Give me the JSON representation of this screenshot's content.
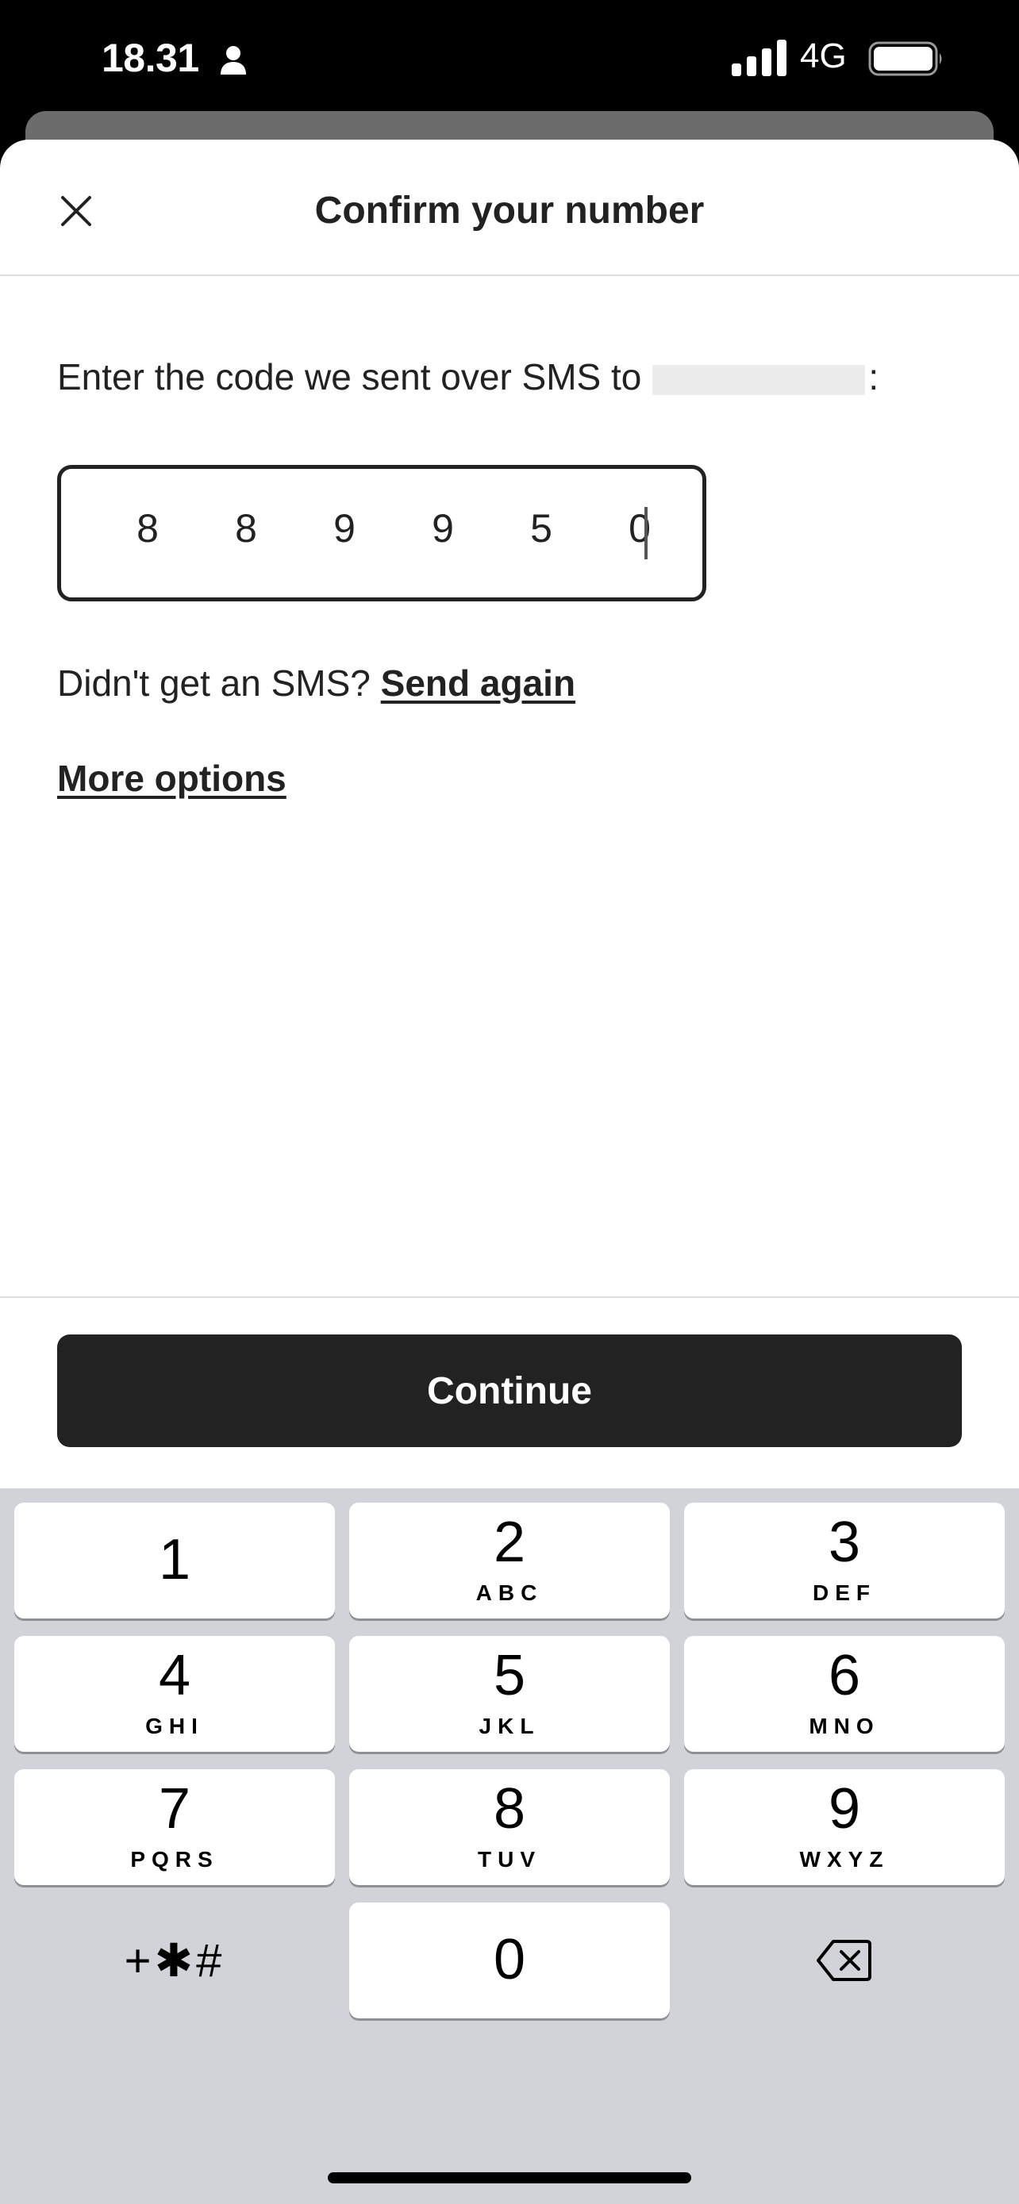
{
  "status_bar": {
    "time": "18.31",
    "network": "4G",
    "icons": [
      "person-icon",
      "signal-icon",
      "battery-icon"
    ]
  },
  "header": {
    "title": "Confirm your number",
    "close_icon": "close-icon"
  },
  "body": {
    "instruction": "Enter the code we sent over SMS to",
    "instruction_suffix": ":",
    "code_digits": [
      "8",
      "8",
      "9",
      "9",
      "5",
      "0"
    ],
    "resend_prompt": "Didn't get an SMS?",
    "resend_link": "Send again",
    "more_options": "More options"
  },
  "footer": {
    "continue_label": "Continue"
  },
  "keypad": {
    "keys": [
      {
        "num": "1",
        "letters": ""
      },
      {
        "num": "2",
        "letters": "ABC"
      },
      {
        "num": "3",
        "letters": "DEF"
      },
      {
        "num": "4",
        "letters": "GHI"
      },
      {
        "num": "5",
        "letters": "JKL"
      },
      {
        "num": "6",
        "letters": "MNO"
      },
      {
        "num": "7",
        "letters": "PQRS"
      },
      {
        "num": "8",
        "letters": "TUV"
      },
      {
        "num": "9",
        "letters": "WXYZ"
      },
      {
        "num": "0",
        "letters": ""
      }
    ],
    "symbols_label": "+✱#",
    "delete_icon": "backspace-icon"
  },
  "colors": {
    "primary_text": "#222222",
    "button_bg": "#222222",
    "keypad_bg": "#d1d3d9",
    "divider": "#dddddd"
  }
}
